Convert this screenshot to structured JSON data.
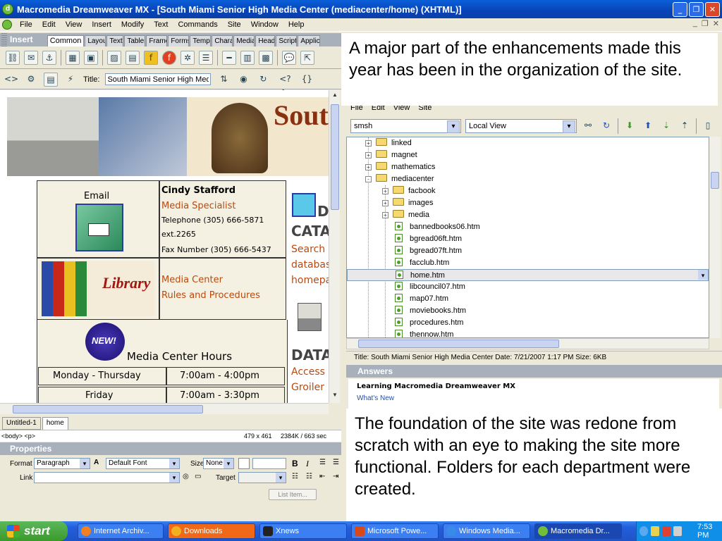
{
  "window": {
    "title": "Macromedia Dreamweaver MX - [South Miami Senior High Media Center (mediacenter/home) (XHTML)]"
  },
  "menu": [
    "File",
    "Edit",
    "View",
    "Insert",
    "Modify",
    "Text",
    "Commands",
    "Site",
    "Window",
    "Help"
  ],
  "insert_panel": {
    "label": "Insert",
    "tabs": [
      "Common",
      "Layout",
      "Text",
      "Tables",
      "Frames",
      "Forms",
      "Templates",
      "Characters",
      "Media",
      "Head",
      "Script",
      "Application"
    ]
  },
  "doc_toolbar": {
    "title_label": "Title:",
    "title_value": "South Miami Senior High Media"
  },
  "design": {
    "banner_text": "Sout",
    "email_label": "Email",
    "contact_name": "Cindy Stafford",
    "contact_role": "Media Specialist",
    "telephone": "Telephone (305) 666-5871",
    "extension": "ext.2265",
    "fax": "Fax Number (305) 666-5437",
    "media_center_link": "Media Center",
    "rules_link": "Rules and Procedures",
    "new_badge": "NEW!",
    "hours_title": "Media Center Hours",
    "hours": [
      {
        "days": "Monday - Thursday",
        "time": "7:00am - 4:00pm"
      },
      {
        "days": "Friday",
        "time": "7:00am - 3:30pm"
      }
    ],
    "side_heading1_a": "D",
    "side_heading1_b": "CATA",
    "side_links": [
      "Search",
      "databas",
      "homepa"
    ],
    "side_heading2": "DATA",
    "side_links2": [
      "Access",
      "Groiler"
    ]
  },
  "doc_tabs": [
    "Untitled-1",
    "home"
  ],
  "status": {
    "tag": "<body> <p>",
    "dims": "479 x 461",
    "size": "2384K / 663 sec"
  },
  "properties": {
    "header": "Properties",
    "format_label": "Format",
    "format_value": "Paragraph",
    "font_value": "Default Font",
    "size_label": "Size",
    "size_value": "None",
    "link_label": "Link",
    "target_label": "Target",
    "list_item_button": "List Item..."
  },
  "slide_text": {
    "top": "A major part of the enhancements made this year has been in the organization of the site.",
    "bottom": "The foundation of the site was redone from scratch with an eye to making the site more functional. Folders for each department were created."
  },
  "files_panel": {
    "menu": [
      "File",
      "Edit",
      "View",
      "Site"
    ],
    "site_value": "smsh",
    "view_value": "Local View",
    "tree": [
      {
        "name": "linked",
        "type": "folder",
        "level": 1,
        "expander": "+"
      },
      {
        "name": "magnet",
        "type": "folder",
        "level": 1,
        "expander": "+"
      },
      {
        "name": "mathematics",
        "type": "folder",
        "level": 1,
        "expander": "+"
      },
      {
        "name": "mediacenter",
        "type": "folder",
        "level": 1,
        "expander": "-"
      },
      {
        "name": "facbook",
        "type": "folder",
        "level": 2,
        "expander": "+"
      },
      {
        "name": "images",
        "type": "folder",
        "level": 2,
        "expander": "+"
      },
      {
        "name": "media",
        "type": "folder",
        "level": 2,
        "expander": "+"
      },
      {
        "name": "bannedbooks06.htm",
        "type": "file",
        "level": 2
      },
      {
        "name": "bgread06ft.htm",
        "type": "file",
        "level": 2
      },
      {
        "name": "bgread07ft.htm",
        "type": "file",
        "level": 2
      },
      {
        "name": "facclub.htm",
        "type": "file",
        "level": 2
      },
      {
        "name": "home.htm",
        "type": "file",
        "level": 2,
        "selected": true
      },
      {
        "name": "libcouncil07.htm",
        "type": "file",
        "level": 2
      },
      {
        "name": "map07.htm",
        "type": "file",
        "level": 2
      },
      {
        "name": "moviebooks.htm",
        "type": "file",
        "level": 2
      },
      {
        "name": "procedures.htm",
        "type": "file",
        "level": 2
      },
      {
        "name": "thennow.htm",
        "type": "file",
        "level": 2
      }
    ],
    "status": "Title: South Miami Senior High Media Center  Date: 7/21/2007 1:17 PM  Size: 6KB"
  },
  "answers_panel": {
    "header": "Answers",
    "heading": "Learning Macromedia Dreamweaver MX",
    "link": "What's New"
  },
  "taskbar": {
    "start": "start",
    "items": [
      {
        "label": "Internet Archiv...",
        "state": "normal"
      },
      {
        "label": "Downloads",
        "state": "highlight"
      },
      {
        "label": "Xnews",
        "state": "normal"
      },
      {
        "label": "Microsoft Powe...",
        "state": "normal"
      },
      {
        "label": "Windows Media...",
        "state": "normal"
      },
      {
        "label": "Macromedia Dr...",
        "state": "active"
      }
    ],
    "clock": "7:53 PM"
  }
}
